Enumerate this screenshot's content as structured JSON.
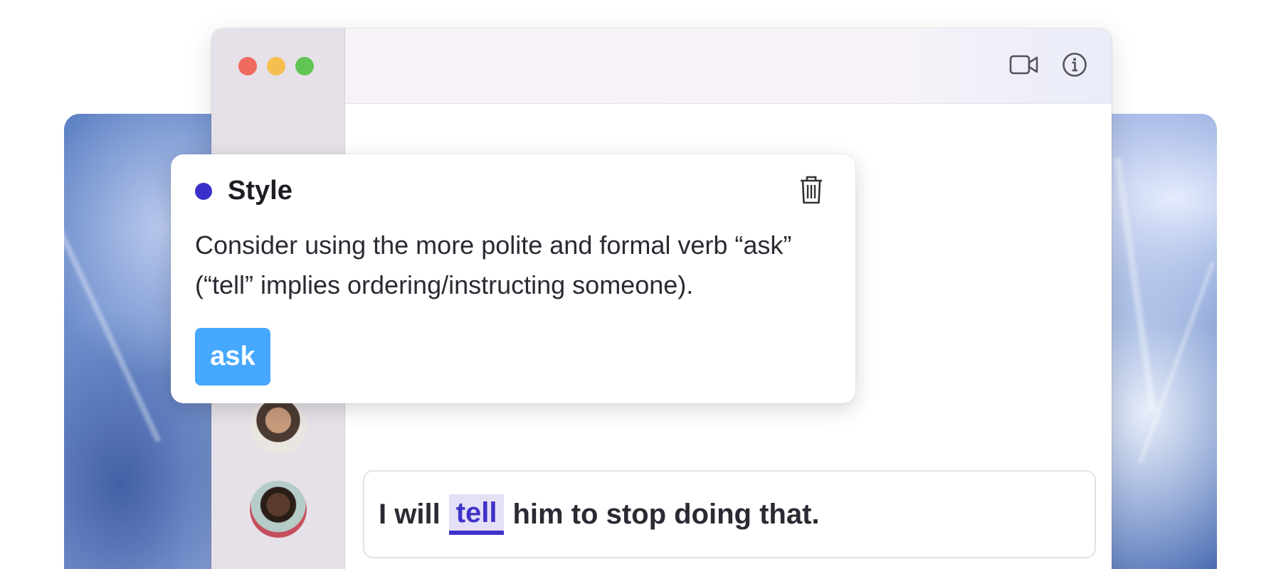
{
  "card": {
    "category": "Style",
    "category_color": "#3b2fc9",
    "message": "Consider using the more polite and formal verb “ask” (“tell” implies ordering/instructing someone).",
    "suggestion": "ask",
    "delete_icon": "trash-icon"
  },
  "toolbar": {
    "video_icon": "video-camera-icon",
    "info_icon": "info-icon"
  },
  "compose": {
    "before": "I will",
    "flagged_word": "tell",
    "after": "him to stop doing that."
  },
  "colors": {
    "accent": "#3b2fc9",
    "suggestion_button": "#46a8ff",
    "highlight_bg": "#e4e0f6"
  }
}
